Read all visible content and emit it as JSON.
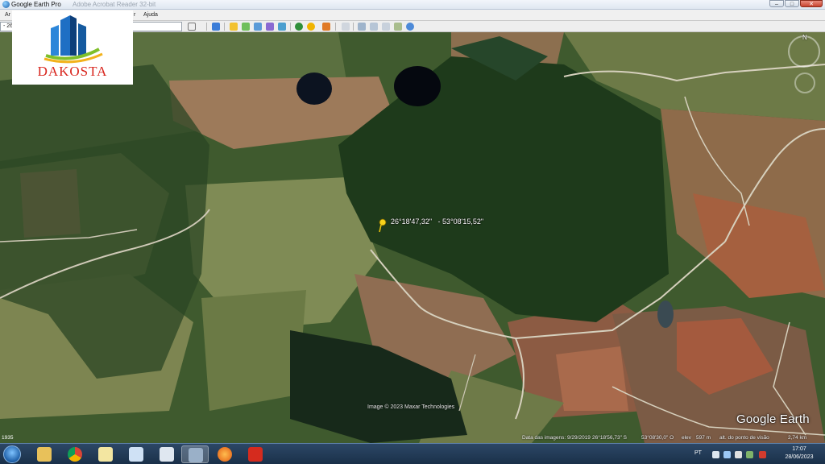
{
  "window": {
    "title": "Google Earth Pro",
    "background_title": "Adobe Acrobat Reader 32-bit"
  },
  "menu": {
    "items": [
      "Ar",
      "r",
      "Ajuda"
    ]
  },
  "toolbar": {
    "search_value": "- 26"
  },
  "logo": {
    "brand": "DAKOSTA"
  },
  "map": {
    "placemark_label": "26°18'47,32\"   - 53°08'15,52\"",
    "attribution": "Image © 2023 Maxar Technologies",
    "brand_logo": "Google Earth",
    "compass_north": "N",
    "status": {
      "imagery_date": "Data das imagens: 9/29/2019",
      "lat": "26°18'56,73\" S",
      "lon": "53°08'30,0\" O",
      "elev_label": "elev",
      "elev": "597 m",
      "eye_alt": "alt. do ponto de visão",
      "eye_alt_value": "2,74 km"
    }
  },
  "taskbar": {
    "left_tray": "1935",
    "language": "PT",
    "time": "17:07",
    "date": "28/06/2023",
    "apps": [
      {
        "name": "explorer-icon",
        "color": "#e8c15a"
      },
      {
        "name": "chrome-icon",
        "color": "#ffffff"
      },
      {
        "name": "notes-icon",
        "color": "#f3e6a1"
      },
      {
        "name": "paint-icon",
        "color": "#cfe1f5"
      },
      {
        "name": "calculator-icon",
        "color": "#dfe7f0"
      },
      {
        "name": "google-earth-pro-icon",
        "color": "#9ab0c8"
      },
      {
        "name": "firefox-icon",
        "color": "#ff8a2b"
      },
      {
        "name": "acrobat-icon",
        "color": "#d52b1e"
      }
    ]
  }
}
